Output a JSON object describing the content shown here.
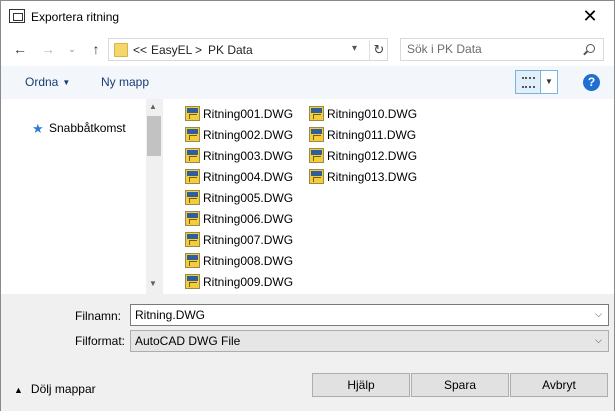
{
  "window": {
    "title": "Exportera ritning",
    "close_label": "✕"
  },
  "nav": {
    "back_icon": "←",
    "forward_icon": "→",
    "recent_icon": "⌄",
    "up_icon": "↑",
    "breadcrumb": [
      "<<",
      "EasyEL",
      ">",
      "PK Data"
    ],
    "refresh_icon": "↻",
    "search_placeholder": "Sök i PK Data"
  },
  "toolbar": {
    "organize_label": "Ordna",
    "new_folder_label": "Ny mapp",
    "help_label": "?"
  },
  "navpane": {
    "quick_access_label": "Snabbåtkomst"
  },
  "files": [
    "Ritning001.DWG",
    "Ritning002.DWG",
    "Ritning003.DWG",
    "Ritning004.DWG",
    "Ritning005.DWG",
    "Ritning006.DWG",
    "Ritning007.DWG",
    "Ritning008.DWG",
    "Ritning009.DWG",
    "Ritning010.DWG",
    "Ritning011.DWG",
    "Ritning012.DWG",
    "Ritning013.DWG"
  ],
  "form": {
    "filename_label": "Filnamn:",
    "filename_value": "Ritning.DWG",
    "format_label": "Filformat:",
    "format_value": "AutoCAD DWG File",
    "hide_folders_label": "Dölj mappar"
  },
  "buttons": {
    "help": "Hjälp",
    "save": "Spara",
    "cancel": "Avbryt"
  }
}
